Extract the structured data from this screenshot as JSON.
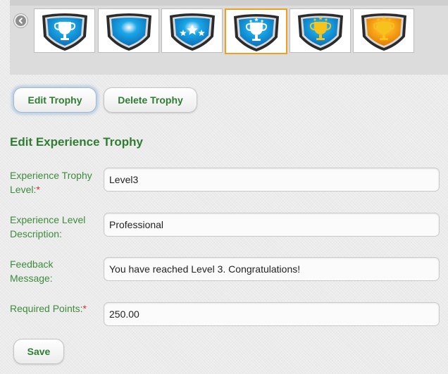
{
  "trophies": [
    {
      "name": "trophy-cup-blue",
      "style": "cup",
      "colors": [
        "#1aa7e8",
        "#0b6fb8"
      ]
    },
    {
      "name": "trophy-plain-blue",
      "style": "plain",
      "colors": [
        "#1aa7e8",
        "#0b6fb8"
      ]
    },
    {
      "name": "trophy-stars-blue",
      "style": "stars",
      "colors": [
        "#1aa7e8",
        "#0b6fb8"
      ]
    },
    {
      "name": "trophy-cup-stars-blue",
      "style": "cupstars",
      "colors": [
        "#1aa7e8",
        "#0b6fb8"
      ],
      "selected": true
    },
    {
      "name": "trophy-gold-cup-blue",
      "style": "goldcup",
      "colors": [
        "#1aa7e8",
        "#0b6fb8"
      ]
    },
    {
      "name": "trophy-gold-cup-orange",
      "style": "goldcup",
      "colors": [
        "#ffb020",
        "#e07b00"
      ]
    }
  ],
  "actions": {
    "edit_label": "Edit Trophy",
    "delete_label": "Delete Trophy"
  },
  "form": {
    "title": "Edit Experience Trophy",
    "fields": [
      {
        "label": "Experience Trophy Level:",
        "required": true,
        "value": "Level3"
      },
      {
        "label": "Experience Level Description:",
        "required": false,
        "value": "Professional"
      },
      {
        "label": "Feedback Message:",
        "required": false,
        "value": "You have reached Level 3. Congratulations!"
      },
      {
        "label": "Required Points:",
        "required": true,
        "value": "250.00"
      }
    ],
    "required_marker": "*",
    "save_label": "Save"
  },
  "colors": {
    "accent_green": "#2e7d32",
    "required_red": "#d32f2f",
    "selected_border": "#f0a020"
  }
}
